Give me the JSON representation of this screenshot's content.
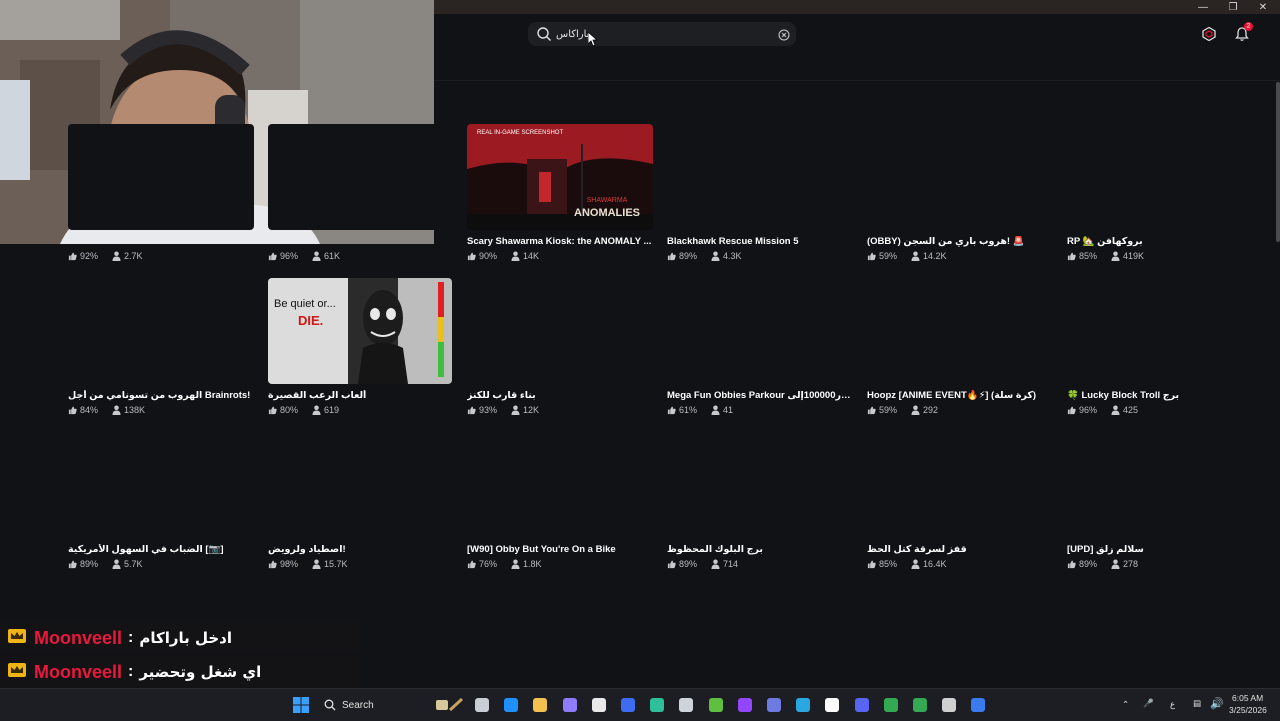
{
  "search": {
    "value": "باراكاس",
    "placeholder": ""
  },
  "header": {
    "notifications_count": "2"
  },
  "games": [
    {
      "title": "",
      "rating": "92%",
      "players": "2.7K"
    },
    {
      "title": "",
      "rating": "96%",
      "players": "61K"
    },
    {
      "title": "Scary Shawarma Kiosk: the ANOMALY ...",
      "rating": "90%",
      "players": "14K",
      "thumb_caption": "REAL IN-GAME SCREENSHOT",
      "thumb_logo_top": "SHAWARMA",
      "thumb_logo_bottom": "ANOMALIES"
    },
    {
      "title": "Blackhawk Rescue Mission 5",
      "rating": "89%",
      "players": "4.3K"
    },
    {
      "title": "(OBBY) هروب باري من السجن! 🚨",
      "rating": "59%",
      "players": "14.2K"
    },
    {
      "title": "RP 🏡 بروكهافن",
      "rating": "85%",
      "players": "419K"
    },
    {
      "title": "الهروب من تسونامي من أجل Brainrots!",
      "rating": "84%",
      "players": "138K"
    },
    {
      "title": "ألعاب الرعب القصيرة",
      "rating": "80%",
      "players": "619",
      "thumb_text_1": "Be quiet or...",
      "thumb_text_2": "DIE."
    },
    {
      "title": "بناء قارب للكنز",
      "rating": "93%",
      "players": "12K"
    },
    {
      "title": "Mega Fun Obbies Parkour دولار100000إلى",
      "rating": "61%",
      "players": "41"
    },
    {
      "title": "Hoopz [ANIME EVENT🔥⚡] (كرة سلة)",
      "rating": "59%",
      "players": "292"
    },
    {
      "title": "🍀 Lucky Block Troll برج",
      "rating": "96%",
      "players": "425"
    },
    {
      "title": "الضباب في السهول الأمريكية [📷]",
      "rating": "89%",
      "players": "5.7K"
    },
    {
      "title": "اصطياد ولرويض!",
      "rating": "98%",
      "players": "15.7K"
    },
    {
      "title": "[W90] Obby But You're On a Bike",
      "rating": "76%",
      "players": "1.8K"
    },
    {
      "title": "برج البلوك المحظوظ",
      "rating": "89%",
      "players": "714"
    },
    {
      "title": "قفز لسرقة كتل الحظ",
      "rating": "85%",
      "players": "16.4K"
    },
    {
      "title": "[UPD] سلالم زلق",
      "rating": "89%",
      "players": "278"
    }
  ],
  "chat": [
    {
      "user": "Moonveell",
      "separator": ":",
      "message": "ادخل باراكام"
    },
    {
      "user": "Moonveell",
      "separator": ":",
      "message": "اي شغل وتحضير"
    }
  ],
  "taskbar": {
    "search_label": "Search",
    "language": "ع",
    "time": "6:05 AM",
    "date": "3/25/2026",
    "icons": [
      "windows-icon",
      "search-icon",
      "widget-icon",
      "file-explorer-icon",
      "edge-icon",
      "folder-icon",
      "copilot-icon",
      "store-icon",
      "app-icon",
      "browser-icon",
      "roblox-studio-icon",
      "minecraft-icon",
      "twitch-icon",
      "app2-icon",
      "app3-icon",
      "tiktok-icon",
      "discord-icon",
      "chrome-icon",
      "chrome2-icon",
      "obs-icon",
      "roblox-icon"
    ]
  },
  "colors": {
    "background": "#111216",
    "accent_red": "#e8193c",
    "stat_text": "#b9bcc3"
  }
}
